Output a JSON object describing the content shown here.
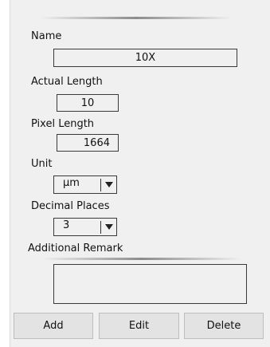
{
  "fields": {
    "name": {
      "label": "Name",
      "value": "10X"
    },
    "actual_length": {
      "label": "Actual Length",
      "value": "10"
    },
    "pixel_length": {
      "label": "Pixel Length",
      "value": "1664"
    },
    "unit": {
      "label": "Unit",
      "value": "μm"
    },
    "decimal_places": {
      "label": "Decimal Places",
      "value": "3"
    },
    "additional_remark": {
      "label": "Additional Remark",
      "value": ""
    }
  },
  "buttons": {
    "add": "Add",
    "edit": "Edit",
    "delete": "Delete"
  },
  "icons": {
    "dropdown": "chevron-down-icon"
  }
}
